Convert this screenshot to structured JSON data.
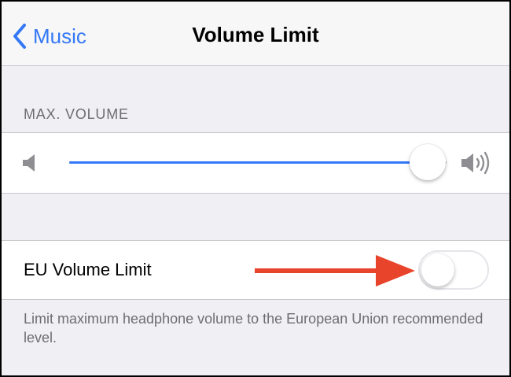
{
  "nav": {
    "back_label": "Music",
    "title": "Volume Limit"
  },
  "volume": {
    "section_header": "MAX. VOLUME",
    "level": 0.95,
    "low_icon": "speaker-low-icon",
    "high_icon": "speaker-high-icon"
  },
  "eu_limit": {
    "label": "EU Volume Limit",
    "enabled": false,
    "footer": "Limit maximum headphone volume to the European Union recommended level."
  },
  "colors": {
    "accent": "#3478f6",
    "arrow": "#e8442c",
    "background": "#efeff4"
  }
}
